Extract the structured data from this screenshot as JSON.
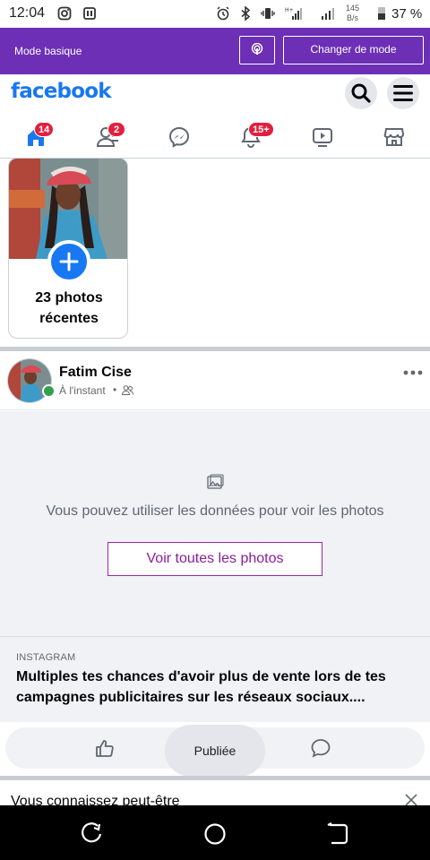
{
  "status_bar": {
    "time": "12:04",
    "net_speed_value": "145",
    "net_speed_unit": "B/s",
    "battery": "37 %",
    "icons": [
      "instagram-icon",
      "sim-card-icon",
      "alarm-icon",
      "bluetooth-icon",
      "vibrate-icon",
      "signal-icon",
      "signal-icon",
      "battery-icon"
    ]
  },
  "basic_bar": {
    "label": "Mode basique",
    "mode_button": "Changer de mode",
    "podcast_icon": "podcast-icon"
  },
  "header": {
    "logo": "facebook",
    "icons": [
      "search-icon",
      "menu-icon"
    ],
    "accent": "#1877f2"
  },
  "tabs": [
    {
      "name": "home",
      "icon": "home-icon",
      "badge": "14"
    },
    {
      "name": "friends",
      "icon": "friends-icon",
      "badge": "2"
    },
    {
      "name": "messenger",
      "icon": "messenger-icon",
      "badge": ""
    },
    {
      "name": "notifications",
      "icon": "bell-icon",
      "badge": "15+"
    },
    {
      "name": "watch",
      "icon": "video-icon",
      "badge": ""
    },
    {
      "name": "marketplace",
      "icon": "marketplace-icon",
      "badge": ""
    }
  ],
  "recent_photos": {
    "label": "23 photos récentes"
  },
  "post": {
    "author": "Fatim Cise",
    "time": "À l'instant",
    "separator": "•",
    "audience_icon": "friends-audience-icon",
    "data_notice": "Vous pouvez utiliser les données pour voir les photos",
    "view_button": "Voir toutes les photos",
    "link_source": "INSTAGRAM",
    "link_title": "Multiples tes chances d'avoir plus de vente lors de tes campagnes publicitaires sur les réseaux sociaux...."
  },
  "actions": {
    "published": "Publiée",
    "like_icon": "like-icon",
    "comment_icon": "comment-icon"
  },
  "suggestions": {
    "title": "Vous connaissez peut-être"
  },
  "colors": {
    "basic_bar": "#6c2fb5",
    "badge": "#e41e3f",
    "online": "#31a24c",
    "button_border": "#9c27b0"
  }
}
